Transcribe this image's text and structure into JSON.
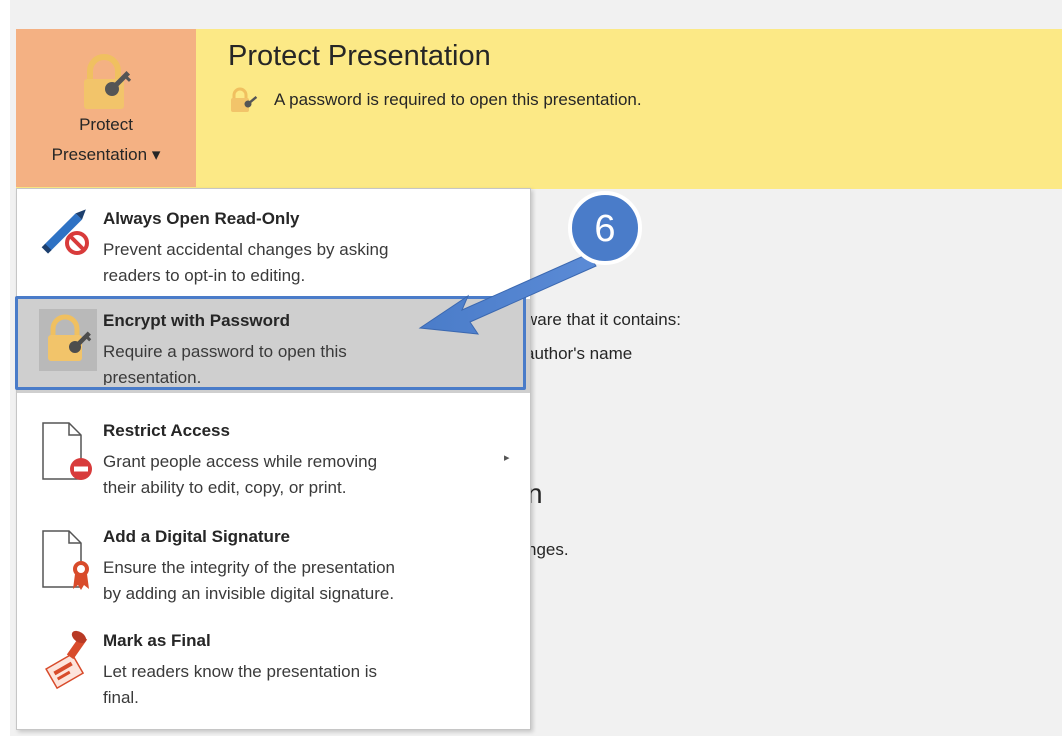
{
  "banner": {
    "button_label_line1": "Protect",
    "button_label_line2": "Presentation ▾",
    "title": "Protect Presentation",
    "description": "A password is required to open this presentation.",
    "colors": {
      "banner": "#fce986",
      "button": "#f4b183"
    }
  },
  "background_text": {
    "line1": "ware that it contains:",
    "line2": "author's name",
    "heading_fragment": "n",
    "line3": "nges."
  },
  "menu": {
    "items": [
      {
        "title": "Always Open Read-Only",
        "desc1": "Prevent accidental changes by asking",
        "desc2": "readers to opt-in to editing.",
        "icon": "pencil-no-icon"
      },
      {
        "title": "Encrypt with Password",
        "desc1": "Require a password to open this",
        "desc2": "presentation.",
        "icon": "lock-key-icon"
      },
      {
        "title": "Restrict Access",
        "desc1": "Grant people access while removing",
        "desc2": "their ability to edit, copy, or print.",
        "icon": "document-restrict-icon",
        "submenu_arrow": "▸"
      },
      {
        "title": "Add a Digital Signature",
        "desc1": "Ensure the integrity of the presentation",
        "desc2": "by adding an invisible digital signature.",
        "icon": "document-ribbon-icon"
      },
      {
        "title": "Mark as Final",
        "desc1": "Let readers know the presentation is",
        "desc2": "final.",
        "icon": "stamp-icon"
      }
    ]
  },
  "annotation": {
    "step_number": "6",
    "color": "#4a7cc9"
  }
}
